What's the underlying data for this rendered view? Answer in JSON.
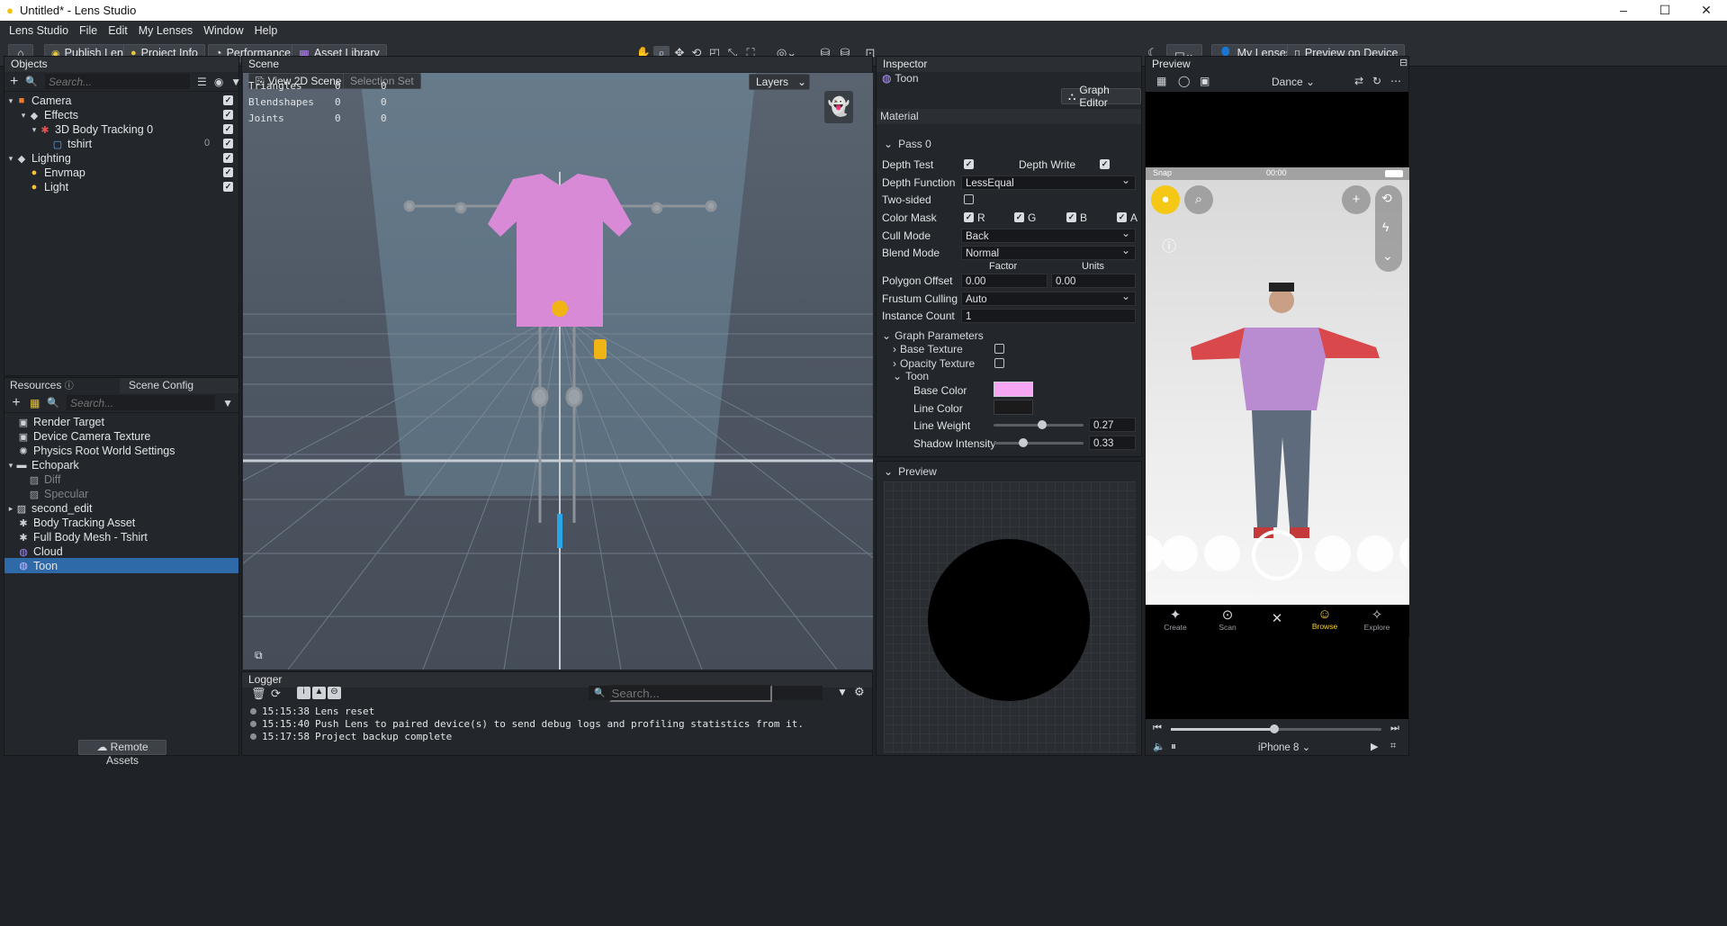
{
  "window": {
    "title": "Untitled* - Lens Studio",
    "logo_icon": "lens-studio-icon"
  },
  "menu": [
    "Lens Studio",
    "File",
    "Edit",
    "My Lenses",
    "Window",
    "Help"
  ],
  "toolbar": {
    "publish": "Publish Lens",
    "project_info": "Project Info",
    "performance": "Performance",
    "asset_library": "Asset Library",
    "my_lenses": "My Lenses",
    "preview_on_device": "Preview on Device"
  },
  "objects": {
    "title": "Objects",
    "search_placeholder": "Search...",
    "tree": [
      {
        "label": "Camera",
        "indent": 0,
        "icon": "camera-icon"
      },
      {
        "label": "Effects",
        "indent": 1,
        "icon": "effects-icon"
      },
      {
        "label": "3D Body Tracking 0",
        "indent": 2,
        "icon": "body-tracking-icon"
      },
      {
        "label": "tshirt",
        "indent": 3,
        "icon": "mesh-icon",
        "count": "0"
      },
      {
        "label": "Lighting",
        "indent": 0,
        "icon": "lighting-icon"
      },
      {
        "label": "Envmap",
        "indent": 1,
        "icon": "light-bulb-icon"
      },
      {
        "label": "Light",
        "indent": 1,
        "icon": "light-bulb-icon"
      }
    ]
  },
  "resources": {
    "title": "Resources",
    "scene_config_tab": "Scene Config",
    "search_placeholder": "Search...",
    "items": [
      {
        "label": "Render Target",
        "icon": "render-target-icon"
      },
      {
        "label": "Device Camera Texture",
        "icon": "camera-texture-icon"
      },
      {
        "label": "Physics Root World Settings",
        "icon": "physics-icon"
      },
      {
        "label": "Echopark",
        "icon": "folder-icon"
      },
      {
        "label": "Diff",
        "icon": "texture-icon"
      },
      {
        "label": "Specular",
        "icon": "texture-icon"
      },
      {
        "label": "second_edit",
        "icon": "texture-icon"
      },
      {
        "label": "Body Tracking Asset",
        "icon": "body-asset-icon"
      },
      {
        "label": "Full Body Mesh - Tshirt",
        "icon": "mesh-asset-icon"
      },
      {
        "label": "Cloud",
        "icon": "material-icon"
      },
      {
        "label": "Toon",
        "icon": "material-icon"
      }
    ],
    "remote_assets": "Remote Assets"
  },
  "scene": {
    "title": "Scene",
    "view2d": "View 2D Scene",
    "selection_set": "Selection Set",
    "layers": "Layers",
    "stats": [
      {
        "label": "Triangles",
        "a": "0",
        "b": "0"
      },
      {
        "label": "Blendshapes",
        "a": "0",
        "b": "0"
      },
      {
        "label": "Joints",
        "a": "0",
        "b": "0"
      }
    ],
    "shirt_color": "#d98ad6"
  },
  "logger": {
    "title": "Logger",
    "search_placeholder": "Search...",
    "lines": [
      {
        "time": "15:15:38",
        "msg": "Lens reset"
      },
      {
        "time": "15:15:40",
        "msg": "Push Lens to paired device(s) to send debug logs and profiling statistics from it."
      },
      {
        "time": "15:17:58",
        "msg": "Project backup complete"
      }
    ]
  },
  "inspector": {
    "title": "Inspector",
    "object_name": "Toon",
    "graph_editor": "Graph Editor",
    "material": "Material",
    "pass": "Pass 0",
    "depth_test": "Depth Test",
    "depth_write": "Depth Write",
    "depth_function_label": "Depth Function",
    "depth_function": "LessEqual",
    "two_sided": "Two-sided",
    "color_mask": "Color Mask",
    "mask_r": "R",
    "mask_g": "G",
    "mask_b": "B",
    "mask_a": "A",
    "cull_mode_label": "Cull Mode",
    "cull_mode": "Back",
    "blend_mode_label": "Blend Mode",
    "blend_mode": "Normal",
    "factor": "Factor",
    "units": "Units",
    "polygon_offset_label": "Polygon Offset",
    "polygon_factor": "0.00",
    "polygon_units": "0.00",
    "frustum_culling_label": "Frustum Culling",
    "frustum_culling": "Auto",
    "instance_count_label": "Instance Count",
    "instance_count": "1",
    "graph_parameters": "Graph Parameters",
    "base_texture": "Base Texture",
    "opacity_texture": "Opacity Texture",
    "toon": "Toon",
    "base_color_label": "Base Color",
    "base_color": "#f7a6f3",
    "line_color_label": "Line Color",
    "line_color": "#1b1b1b",
    "line_weight_label": "Line Weight",
    "line_weight": "0.27",
    "shadow_intensity_label": "Shadow Intensity",
    "shadow_intensity": "0.33"
  },
  "material_preview": {
    "title": "Preview"
  },
  "device_preview": {
    "title": "Preview",
    "mode": "Dance",
    "status_carrier": "Snap",
    "status_time": "00:00",
    "nav": [
      {
        "label": "Create",
        "icon": "create-icon"
      },
      {
        "label": "Scan",
        "icon": "scan-icon"
      },
      {
        "label": "",
        "icon": "close-icon"
      },
      {
        "label": "Browse",
        "icon": "smile-icon"
      },
      {
        "label": "Explore",
        "icon": "explore-icon"
      }
    ],
    "device": "iPhone 8",
    "playback_progress": 0.49
  }
}
